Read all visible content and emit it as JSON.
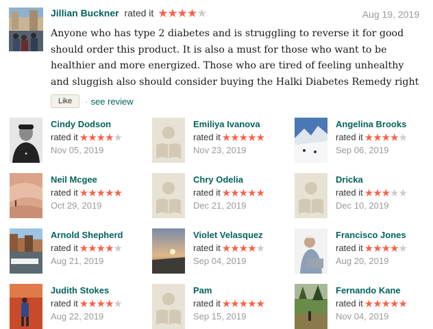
{
  "top_review": {
    "user": "Jillian Buckner",
    "rated_label": "rated it",
    "rating": 4,
    "date": "Aug 19, 2019",
    "body": "Anyone who has type 2 diabetes and is struggling to reverse it for good should order this product. It is also a must for those who want to be healthier and more energized. Those who are tired of feeling unhealthy and sluggish also should consider buying the Halki Diabetes Remedy right away",
    "like_label": "Like",
    "see_review_label": "see review"
  },
  "colors": {
    "accent": "#00635d",
    "star": "#fa604a",
    "star_off": "#cccccc"
  },
  "ratings": [
    {
      "name": "Cindy Dodson",
      "rated_label": "rated it",
      "rating": 4,
      "date": "Nov 05, 2019",
      "avatar": "photo-man-cap"
    },
    {
      "name": "Emiliya Ivanova",
      "rated_label": "rated it",
      "rating": 5,
      "date": "Nov 23, 2019",
      "avatar": "default-book-icon"
    },
    {
      "name": "Angelina Brooks",
      "rated_label": "rated it",
      "rating": 4,
      "date": "Sep 06, 2019",
      "avatar": "photo-snow-mountain"
    },
    {
      "name": "Neil Mcgee",
      "rated_label": "rated it",
      "rating": 5,
      "date": "Oct 29, 2019",
      "avatar": "photo-sand"
    },
    {
      "name": "Chry Odelia",
      "rated_label": "rated it",
      "rating": 5,
      "date": "Dec 21, 2019",
      "avatar": "default-book-icon"
    },
    {
      "name": "Dricka",
      "rated_label": "rated it",
      "rating": 3,
      "date": "Dec 10, 2019",
      "avatar": "default-book-icon"
    },
    {
      "name": "Arnold Shepherd",
      "rated_label": "rated it",
      "rating": 4,
      "date": "Aug 21, 2019",
      "avatar": "photo-canal"
    },
    {
      "name": "Violet Velasquez",
      "rated_label": "rated it",
      "rating": 4,
      "date": "Sep 04, 2019",
      "avatar": "photo-sunset"
    },
    {
      "name": "Francisco Jones",
      "rated_label": "rated it",
      "rating": 4,
      "date": "Aug 20, 2019",
      "avatar": "photo-man-laptop"
    },
    {
      "name": "Judith Stokes",
      "rated_label": "rated it",
      "rating": 4,
      "date": "Aug 22, 2019",
      "avatar": "photo-hiker"
    },
    {
      "name": "Pam",
      "rated_label": "rated it",
      "rating": 5,
      "date": "Sep 15, 2019",
      "avatar": "default-book-icon"
    },
    {
      "name": "Fernando Kane",
      "rated_label": "rated it",
      "rating": 5,
      "date": "Nov 04, 2019",
      "avatar": "photo-forest"
    }
  ]
}
